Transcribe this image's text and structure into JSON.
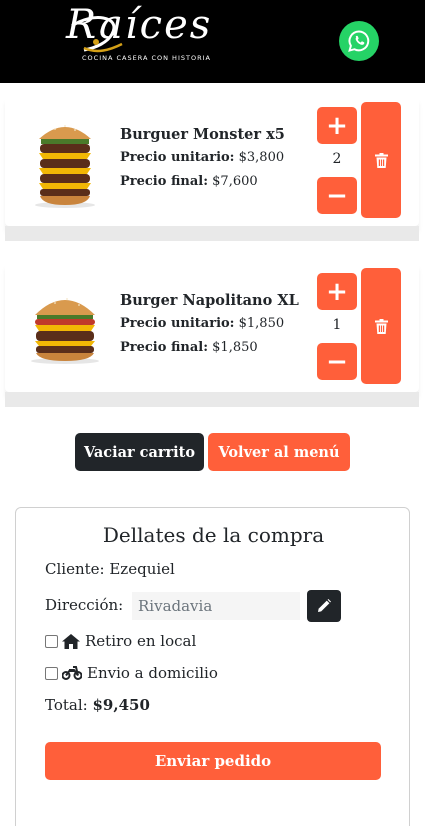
{
  "header": {
    "logo_text": "Raíces",
    "logo_subtitle": "COCINA CASERA CON HISTORIA",
    "whatsapp_icon": "whatsapp-icon",
    "background": "#000000",
    "whatsapp_color": "#25d366"
  },
  "cart": {
    "items": [
      {
        "name": "Burguer Monster x5",
        "unit_label": "Precio unitario:",
        "unit_price": "$3,800",
        "final_label": "Precio final:",
        "final_price": "$7,600",
        "quantity": "2",
        "plus_icon": "plus-icon",
        "minus_icon": "minus-icon",
        "delete_icon": "trash-icon"
      },
      {
        "name": "Burger Napolitano XL",
        "unit_label": "Precio unitario:",
        "unit_price": "$1,850",
        "final_label": "Precio final:",
        "final_price": "$1,850",
        "quantity": "1",
        "plus_icon": "plus-icon",
        "minus_icon": "minus-icon",
        "delete_icon": "trash-icon"
      }
    ]
  },
  "actions": {
    "empty_cart": "Vaciar carrito",
    "back_to_menu": "Volver al menú"
  },
  "details": {
    "title": "Dellates de la compra",
    "client_label": "Cliente:",
    "client_name": "Ezequiel",
    "address_label": "Dirección:",
    "address_value": "Rivadavia",
    "pickup_label": "Retiro en local",
    "delivery_label": "Envio a domicilio",
    "total_label": "Total:",
    "total_value": "$9,450",
    "send_button": "Enviar pedido"
  },
  "colors": {
    "accent": "#ff5f3a",
    "dark": "#212529"
  }
}
